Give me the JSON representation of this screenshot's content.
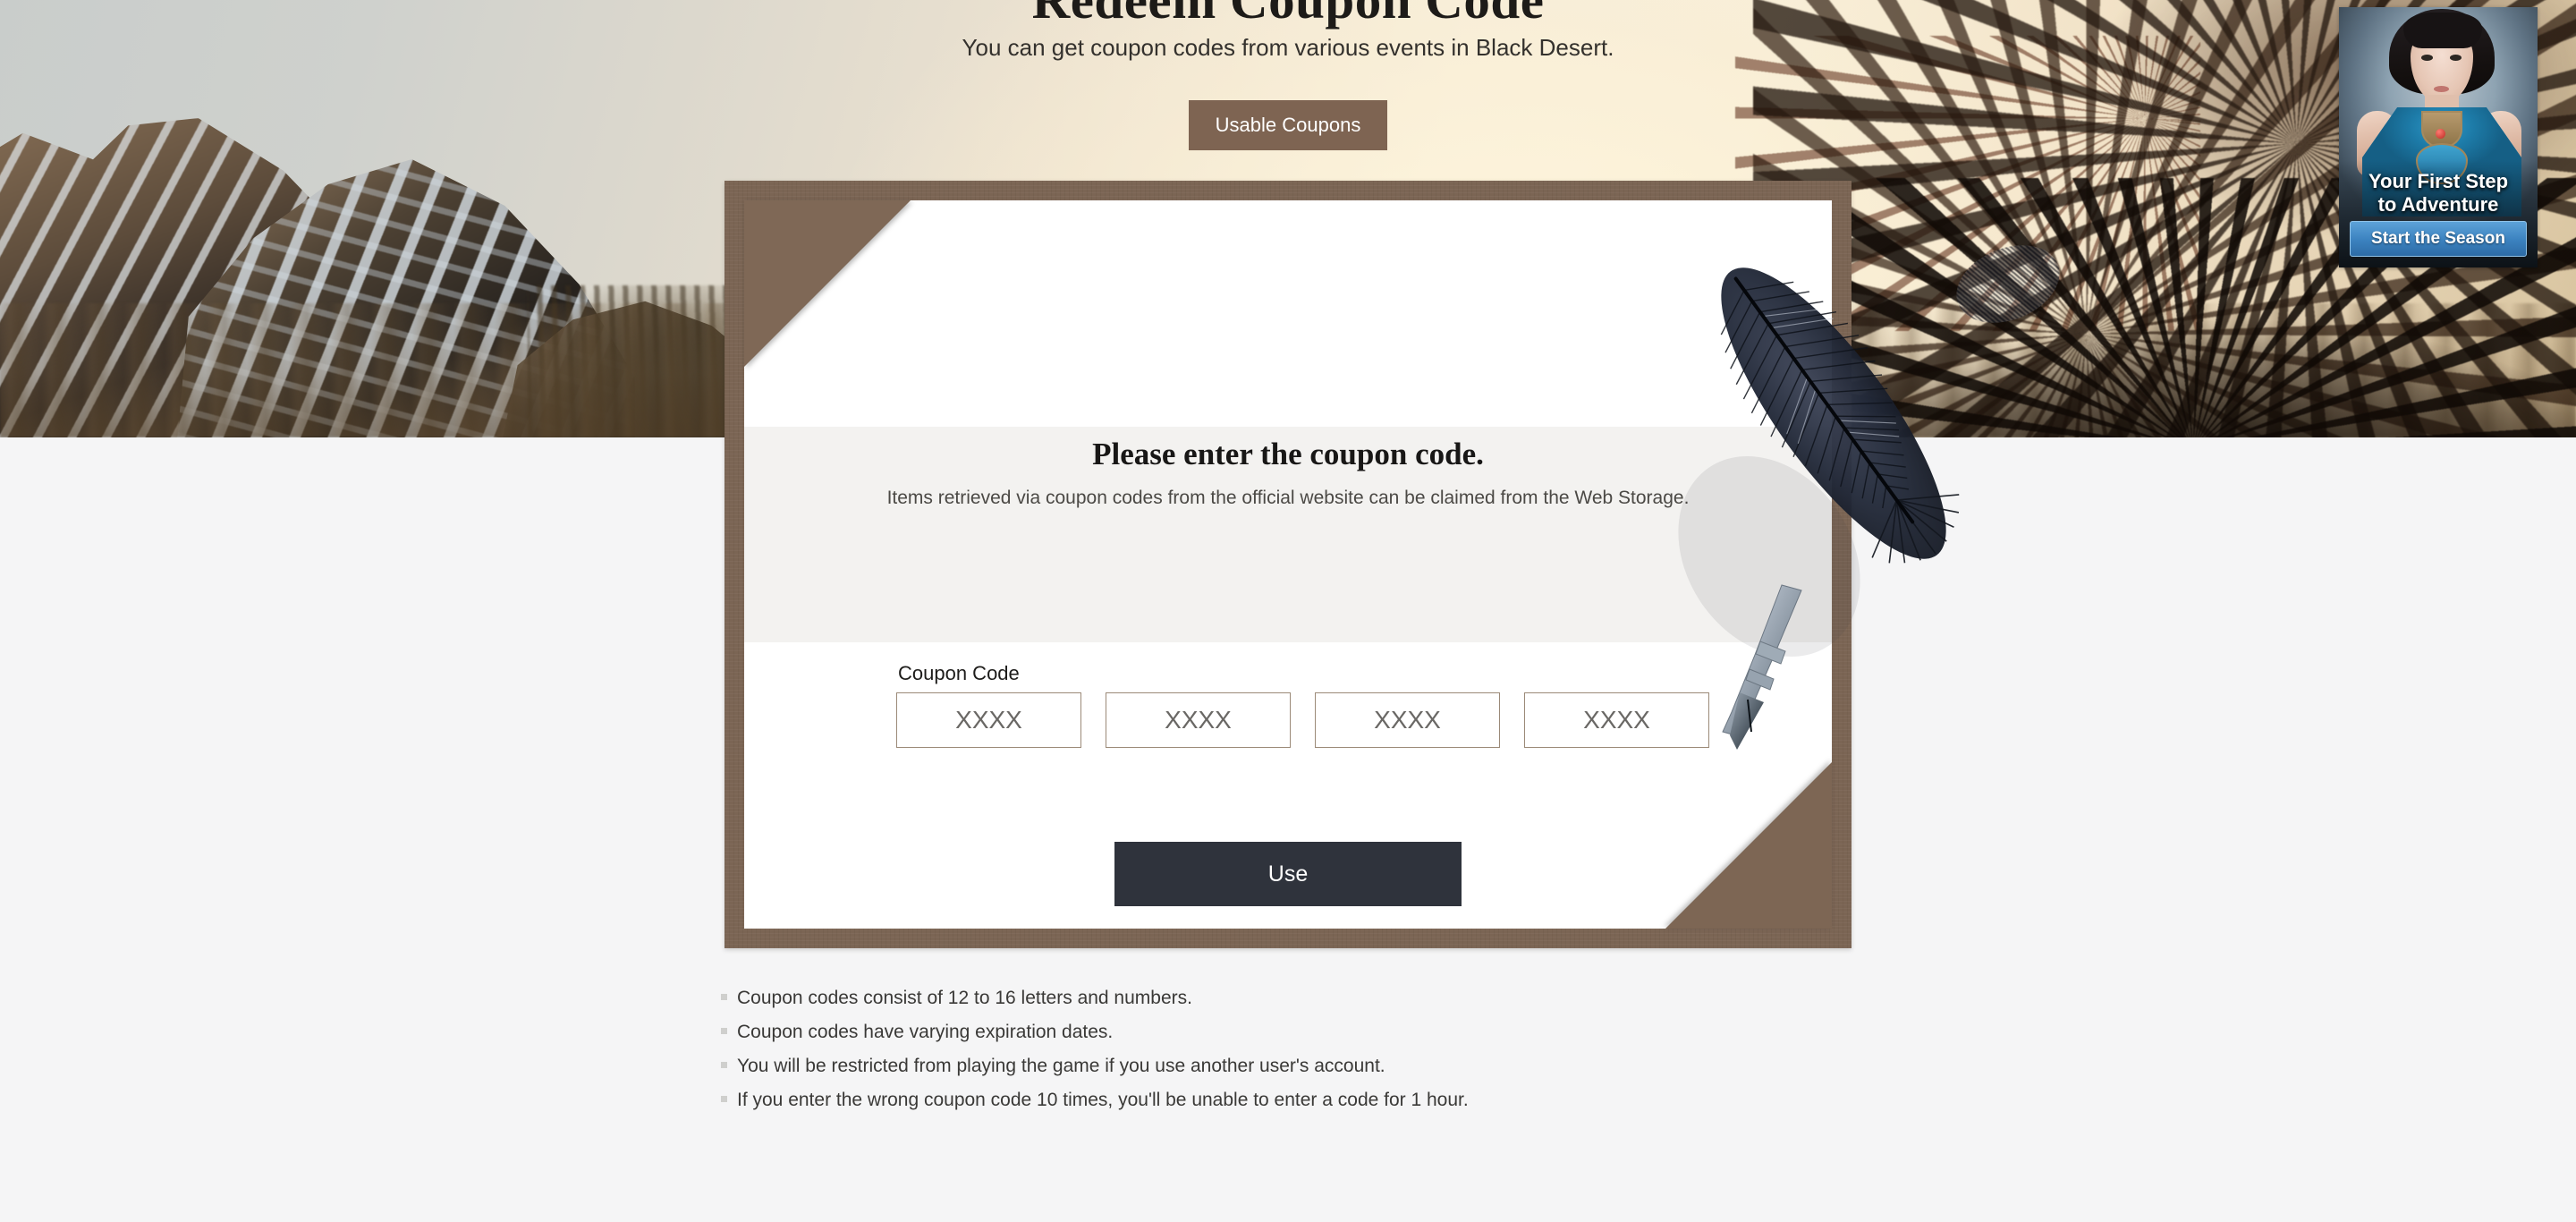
{
  "hero": {
    "title": "Redeem Coupon Code",
    "subtitle": "You can get coupon codes from various events in Black Desert.",
    "usable_coupons_label": "Usable Coupons"
  },
  "card": {
    "title": "Please enter the coupon code.",
    "description": "Items retrieved via coupon codes from the official website can be claimed from the Web Storage.",
    "coupon_label": "Coupon Code",
    "inputs": [
      {
        "value": "",
        "placeholder": "XXXX"
      },
      {
        "value": "",
        "placeholder": "XXXX"
      },
      {
        "value": "",
        "placeholder": "XXXX"
      },
      {
        "value": "",
        "placeholder": "XXXX"
      }
    ],
    "use_label": "Use"
  },
  "side_banner": {
    "title_line1": "Your First Step",
    "title_line2": "to Adventure",
    "cta_label": "Start the Season"
  },
  "notes": [
    "Coupon codes consist of 12 to 16 letters and numbers.",
    "Coupon codes have varying expiration dates.",
    "You will be restricted from playing the game if you use another user's account.",
    "If you enter the wrong coupon code 10 times, you'll be unable to enter a code for 1 hour."
  ],
  "colors": {
    "page_background": "#f5f5f6",
    "envelope_brown": "#7b6554",
    "usable_button": "#7e6452",
    "use_button": "#2f333c",
    "input_border": "#9b8a78",
    "band_grey": "#f3f2f0",
    "cta_blue": "#3c83c0"
  }
}
